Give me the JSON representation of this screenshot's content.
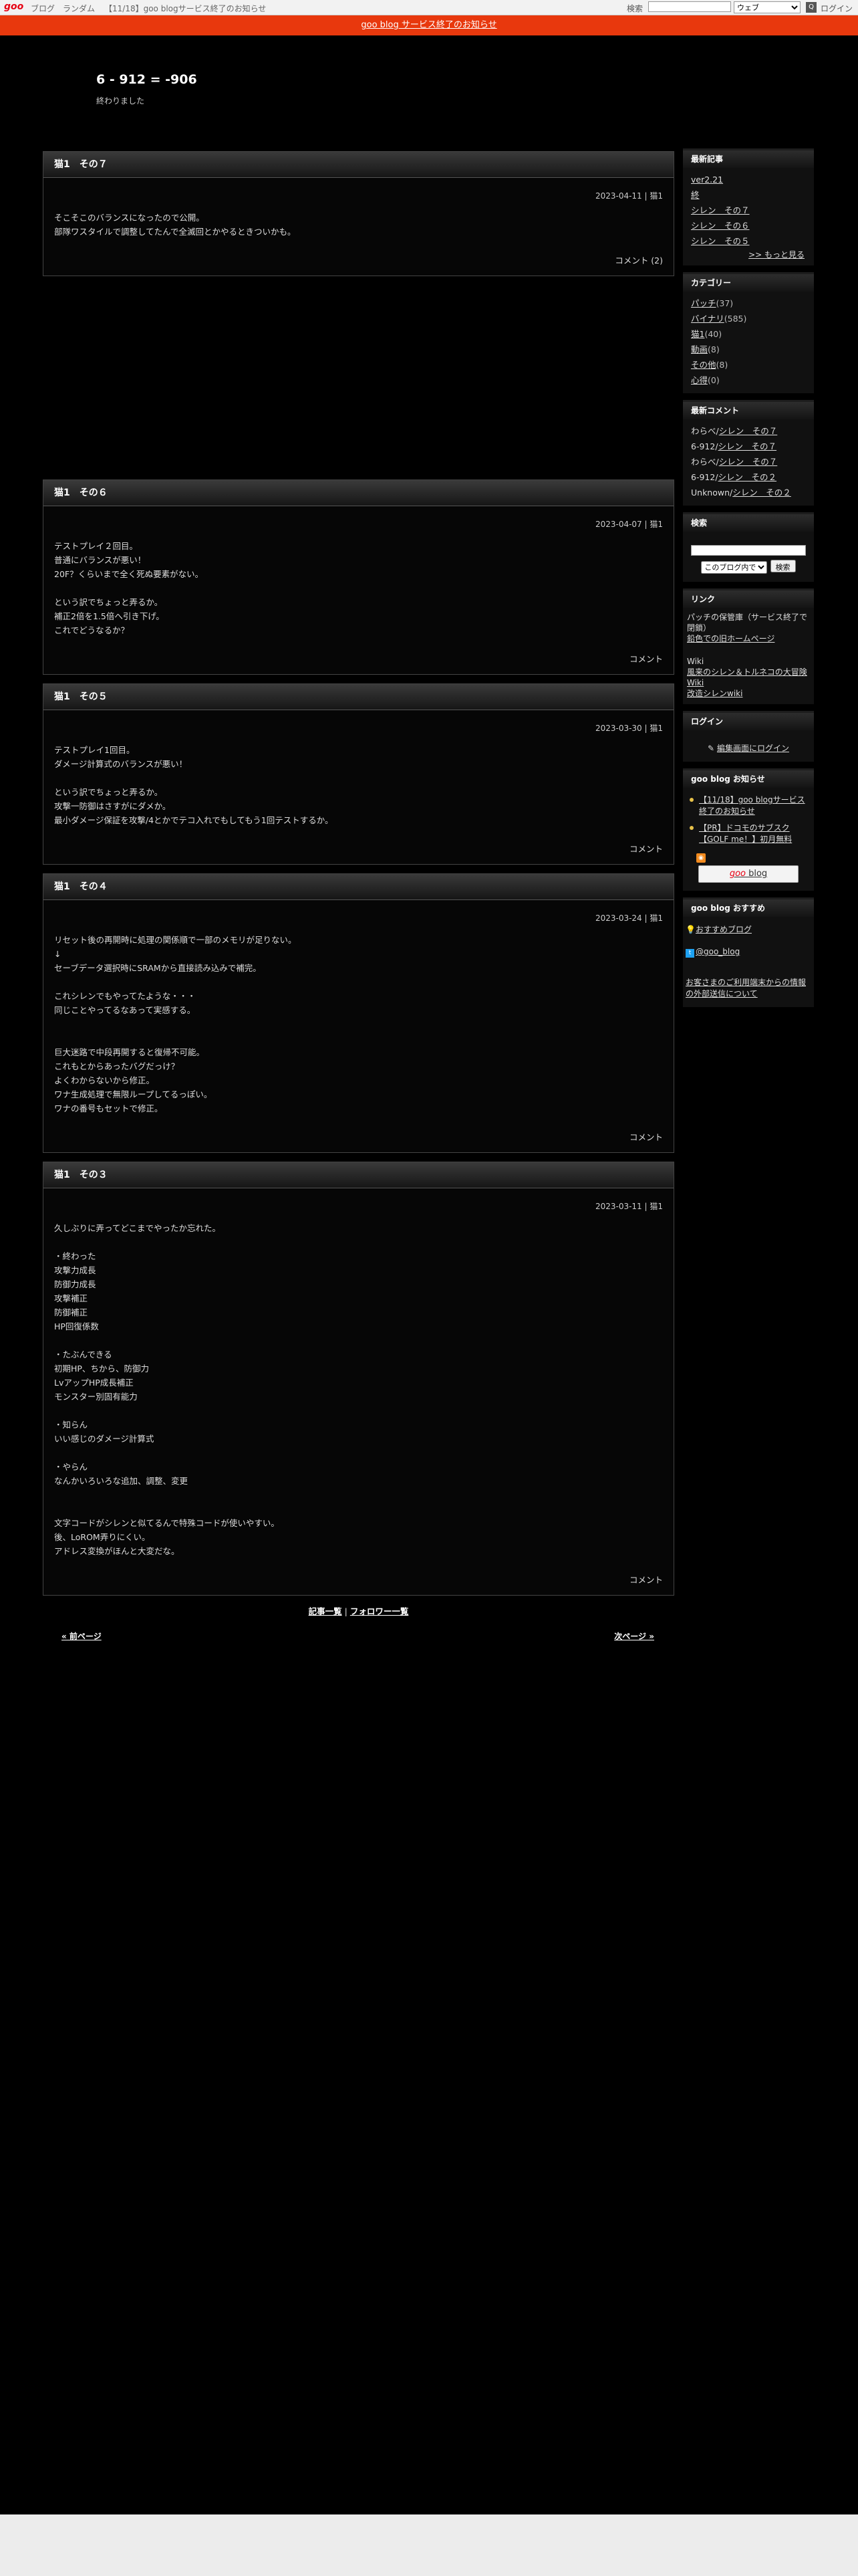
{
  "topbar": {
    "logo": "goo",
    "links": [
      "ブログ",
      "ランダム",
      "【11/18】goo blogサービス終了のお知らせ"
    ],
    "search_label": "検索",
    "search_select": "ウェブ",
    "search_go": "Q",
    "login": "ログイン"
  },
  "notice": "goo blog サービス終了のお知らせ",
  "header": {
    "title": "6 - 912 = -906",
    "description": "終わりました"
  },
  "entries": [
    {
      "title": "猫1　その７",
      "meta": "2023-04-11 | 猫1",
      "body": "そこそこのバランスになったので公開。\n部隊ワスタイルで調整してたんで全滅回とかやるときついかも。",
      "footer": "コメント (2)"
    },
    {
      "title": "猫1　その６",
      "meta": "2023-04-07 | 猫1",
      "body": "テストプレイ２回目。\n普通にバランスが悪い！\n20F？くらいまで全く死ぬ要素がない。\n\nという訳でちょっと弄るか。\n補正2倍を1.5倍へ引き下げ。\nこれでどうなるか？",
      "footer": "コメント"
    },
    {
      "title": "猫1　その５",
      "meta": "2023-03-30 | 猫1",
      "body": "テストプレイ1回目。\nダメージ計算式のバランスが悪い！\n\nという訳でちょっと弄るか。\n攻撃一防御はさすがにダメか。\n最小ダメージ保証を攻撃/4とかでテコ入れでもしてもう1回テストするか。",
      "footer": "コメント"
    },
    {
      "title": "猫1　その４",
      "meta": "2023-03-24 | 猫1",
      "body": "リセット後の再開時に処理の関係順で一部のメモリが足りない。\n↓\nセーブデータ選択時にSRAMから直接読み込みで補完。\n\nこれシレンでもやってたような・・・\n同じことやってるなあって実感する。\n\n\n巨大迷路で中段再開すると復帰不可能。\nこれもとからあったバグだっけ？\nよくわからないから修正。\nワナ生成処理で無限ループしてるっぽい。\nワナの番号もセットで修正。",
      "footer": "コメント"
    },
    {
      "title": "猫1　その３",
      "meta": "2023-03-11 | 猫1",
      "body": "久しぶりに弄ってどこまでやったか忘れた。\n\n・終わった\n攻撃力成長\n防御力成長\n攻撃補正\n防御補正\nHP回復係数\n\n・たぶんできる\n初期HP、ちから、防御力\nLvアップHP成長補正\nモンスター別固有能力\n\n・知らん\nいい感じのダメージ計算式\n\n・やらん\nなんかいろいろな追加、調整、変更\n\n\n文字コードがシレンと似てるんで特殊コードが使いやすい。\n後、LoROM弄りにくい。\nアドレス変換がほんと大変だな。",
      "footer": "コメント"
    }
  ],
  "bottom": {
    "articles": "記事一覧",
    "sep": "|",
    "followers": "フォロワー一覧"
  },
  "pager": {
    "prev": "« 前ページ",
    "next": "次ページ »"
  },
  "sidebar": {
    "recent_title": "最新記事",
    "recent": [
      "ver2.21",
      "終",
      "シレン　その７",
      "シレン　その６",
      "シレン　その５"
    ],
    "recent_more": ">> もっと見る",
    "categories_title": "カテゴリー",
    "categories": [
      {
        "name": "パッチ",
        "count": "(37)"
      },
      {
        "name": "バイナリ",
        "count": "(585)"
      },
      {
        "name": "猫1",
        "count": "(40)"
      },
      {
        "name": "動画",
        "count": "(8)"
      },
      {
        "name": "その他",
        "count": "(8)"
      },
      {
        "name": "心得",
        "count": "(0)"
      }
    ],
    "comments_title": "最新コメント",
    "comments": [
      {
        "who": "わらべ/",
        "post": "シレン　その７"
      },
      {
        "who": "6-912/",
        "post": "シレン　その７"
      },
      {
        "who": "わらべ/",
        "post": "シレン　その７"
      },
      {
        "who": "6-912/",
        "post": "シレン　その２"
      },
      {
        "who": "Unknown/",
        "post": "シレン　その２"
      }
    ],
    "search_title": "検索",
    "search_scope": "このブログ内で",
    "search_button": "検索",
    "links_title": "リンク",
    "links_text1": "パッチの保管庫（サービス終了で閉鎖）",
    "links_item1": "鉛色での旧ホームページ",
    "links_text2": "Wiki",
    "links_item2": "風来のシレン＆トルネコの大冒険 Wiki",
    "links_item3": "改造シレンwiki",
    "login_title": "ログイン",
    "login_link": "編集画面にログイン",
    "notice_title": "goo blog お知らせ",
    "notices": [
      "【11/18】goo blogサービス終了のお知らせ",
      "【PR】ドコモのサブスク【GOLF me！】初月無料"
    ],
    "goo_logo": "goo",
    "goo_word": " blog",
    "rec_title": "goo blog おすすめ",
    "rec_link": "おすすめブログ",
    "twitter": "@goo_blog",
    "external": "お客さまのご利用端末からの情報の外部送信について"
  }
}
